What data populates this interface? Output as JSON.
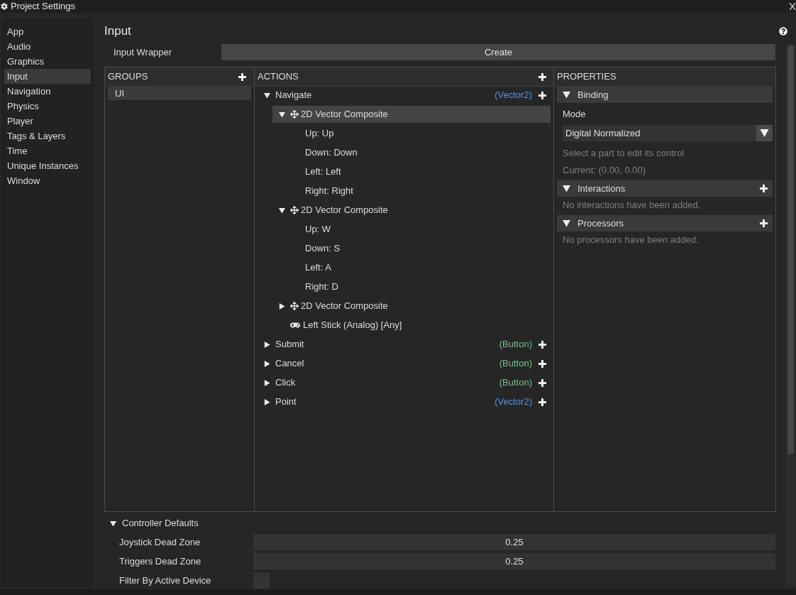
{
  "window": {
    "title": "Project Settings"
  },
  "sidebar": {
    "items": [
      {
        "label": "App",
        "selected": false
      },
      {
        "label": "Audio",
        "selected": false
      },
      {
        "label": "Graphics",
        "selected": false
      },
      {
        "label": "Input",
        "selected": true
      },
      {
        "label": "Navigation",
        "selected": false
      },
      {
        "label": "Physics",
        "selected": false
      },
      {
        "label": "Player",
        "selected": false
      },
      {
        "label": "Tags & Layers",
        "selected": false
      },
      {
        "label": "Time",
        "selected": false
      },
      {
        "label": "Unique Instances",
        "selected": false
      },
      {
        "label": "Window",
        "selected": false
      }
    ]
  },
  "page": {
    "title": "Input"
  },
  "input_wrapper": {
    "label": "Input Wrapper",
    "button": "Create"
  },
  "groups": {
    "header": "GROUPS",
    "items": [
      {
        "label": "UI",
        "selected": true
      }
    ]
  },
  "actions": {
    "header": "ACTIONS",
    "items": [
      {
        "kind": "action",
        "label": "Navigate",
        "value_type": "(Vector2)",
        "color": "#4f96e0",
        "expanded": true,
        "selected": false,
        "children": [
          {
            "kind": "composite",
            "label": "2D Vector Composite",
            "expanded": true,
            "selected": true,
            "children": [
              {
                "kind": "part",
                "label": "Up: Up",
                "selected": false
              },
              {
                "kind": "part",
                "label": "Down: Down",
                "selected": false
              },
              {
                "kind": "part",
                "label": "Left: Left",
                "selected": false
              },
              {
                "kind": "part",
                "label": "Right: Right",
                "selected": false
              }
            ]
          },
          {
            "kind": "composite",
            "label": "2D Vector Composite",
            "expanded": true,
            "selected": false,
            "children": [
              {
                "kind": "part",
                "label": "Up: W",
                "selected": false
              },
              {
                "kind": "part",
                "label": "Down: S",
                "selected": false
              },
              {
                "kind": "part",
                "label": "Left: A",
                "selected": false
              },
              {
                "kind": "part",
                "label": "Right: D",
                "selected": false
              }
            ]
          },
          {
            "kind": "composite",
            "label": "2D Vector Composite",
            "expanded": false,
            "selected": false
          },
          {
            "kind": "binding",
            "label": "Left Stick (Analog) [Any]",
            "selected": false
          }
        ]
      },
      {
        "kind": "action",
        "label": "Submit",
        "value_type": "(Button)",
        "color": "#73c08f",
        "expanded": false,
        "selected": false
      },
      {
        "kind": "action",
        "label": "Cancel",
        "value_type": "(Button)",
        "color": "#73c08f",
        "expanded": false,
        "selected": false
      },
      {
        "kind": "action",
        "label": "Click",
        "value_type": "(Button)",
        "color": "#73c08f",
        "expanded": false,
        "selected": false
      },
      {
        "kind": "action",
        "label": "Point",
        "value_type": "(Vector2)",
        "color": "#4f96e0",
        "expanded": false,
        "selected": false
      }
    ]
  },
  "properties": {
    "header": "PROPERTIES",
    "sections": [
      {
        "title": "Binding",
        "expanded": true,
        "addable": false,
        "fields": [
          {
            "kind": "label",
            "text": "Mode"
          },
          {
            "kind": "dropdown",
            "value": "Digital Normalized"
          },
          {
            "kind": "note",
            "text": "Select a part to edit its control"
          },
          {
            "kind": "note",
            "text": "Current: (0.00, 0.00)"
          }
        ]
      },
      {
        "title": "Interactions",
        "expanded": true,
        "addable": true,
        "fields": [
          {
            "kind": "note",
            "text": "No interactions have been added."
          }
        ]
      },
      {
        "title": "Processors",
        "expanded": true,
        "addable": true,
        "fields": [
          {
            "kind": "note",
            "text": "No processors have been added."
          }
        ]
      }
    ]
  },
  "controller_defaults": {
    "title": "Controller Defaults",
    "expanded": true,
    "fields": [
      {
        "kind": "number",
        "label": "Joystick Dead Zone",
        "value": "0.25"
      },
      {
        "kind": "number",
        "label": "Triggers Dead Zone",
        "value": "0.25"
      },
      {
        "kind": "checkbox",
        "label": "Filter By Active Device",
        "checked": false
      }
    ]
  }
}
